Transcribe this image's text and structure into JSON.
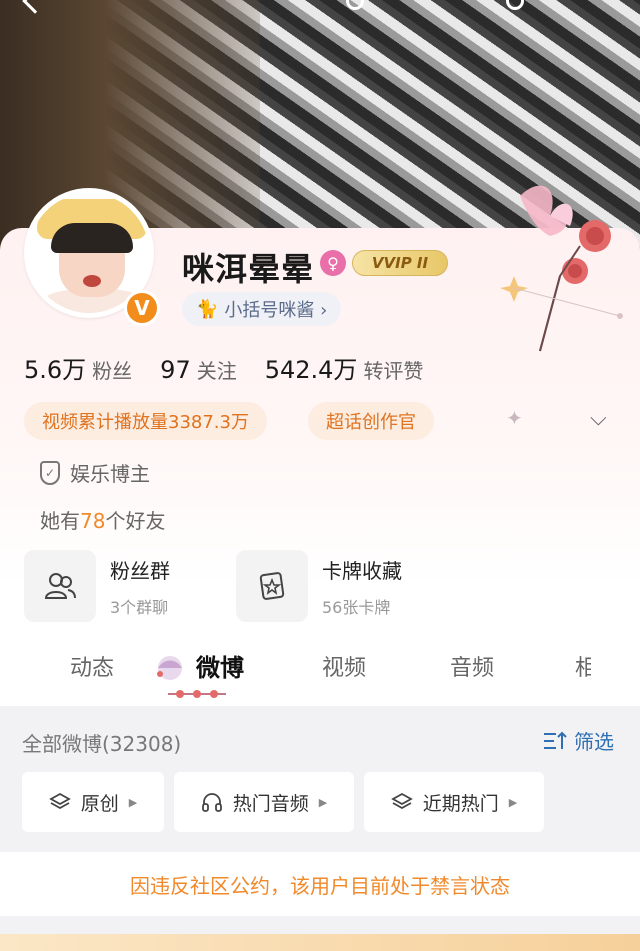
{
  "profile": {
    "name": "咪洱晕晕",
    "vip_label": "VVIP II",
    "verified_badge": "V",
    "gender_symbol": "♀",
    "sub_account": "小括号咪酱 ›",
    "cat_glyph": "🐈"
  },
  "stats": [
    {
      "num": "5.6万",
      "label": "粉丝"
    },
    {
      "num": "97",
      "label": "关注"
    },
    {
      "num": "542.4万",
      "label": "转评赞"
    }
  ],
  "tags": [
    "视频累计播放量3387.3万",
    "超话创作官"
  ],
  "expand_icon": "⌵",
  "blogger": {
    "icon": "shield-icon",
    "label": "娱乐博主"
  },
  "friends": {
    "prefix": "她有",
    "count": "78",
    "suffix": "个好友"
  },
  "features": [
    {
      "title": "粉丝群",
      "sub": "3个群聊"
    },
    {
      "title": "卡牌收藏",
      "sub": "56张卡牌"
    }
  ],
  "tabs": [
    "动态",
    "微博",
    "视频",
    "音频",
    "相"
  ],
  "active_tab": 1,
  "weibo": {
    "all_count_label": "全部微博(32308)",
    "filter_label": "筛选"
  },
  "chips": [
    {
      "label": "原创",
      "icon": "layers-icon"
    },
    {
      "label": "热门音频",
      "icon": "headphones-icon"
    },
    {
      "label": "近期热门",
      "icon": "layers-icon"
    }
  ],
  "notice": "因违反社区公约，该用户目前处于禁言状态",
  "colors": {
    "accent_orange": "#f0892b",
    "link_blue": "#2f6fb4",
    "verified_orange": "#f28c1a",
    "gender_pink": "#e96fa9"
  }
}
